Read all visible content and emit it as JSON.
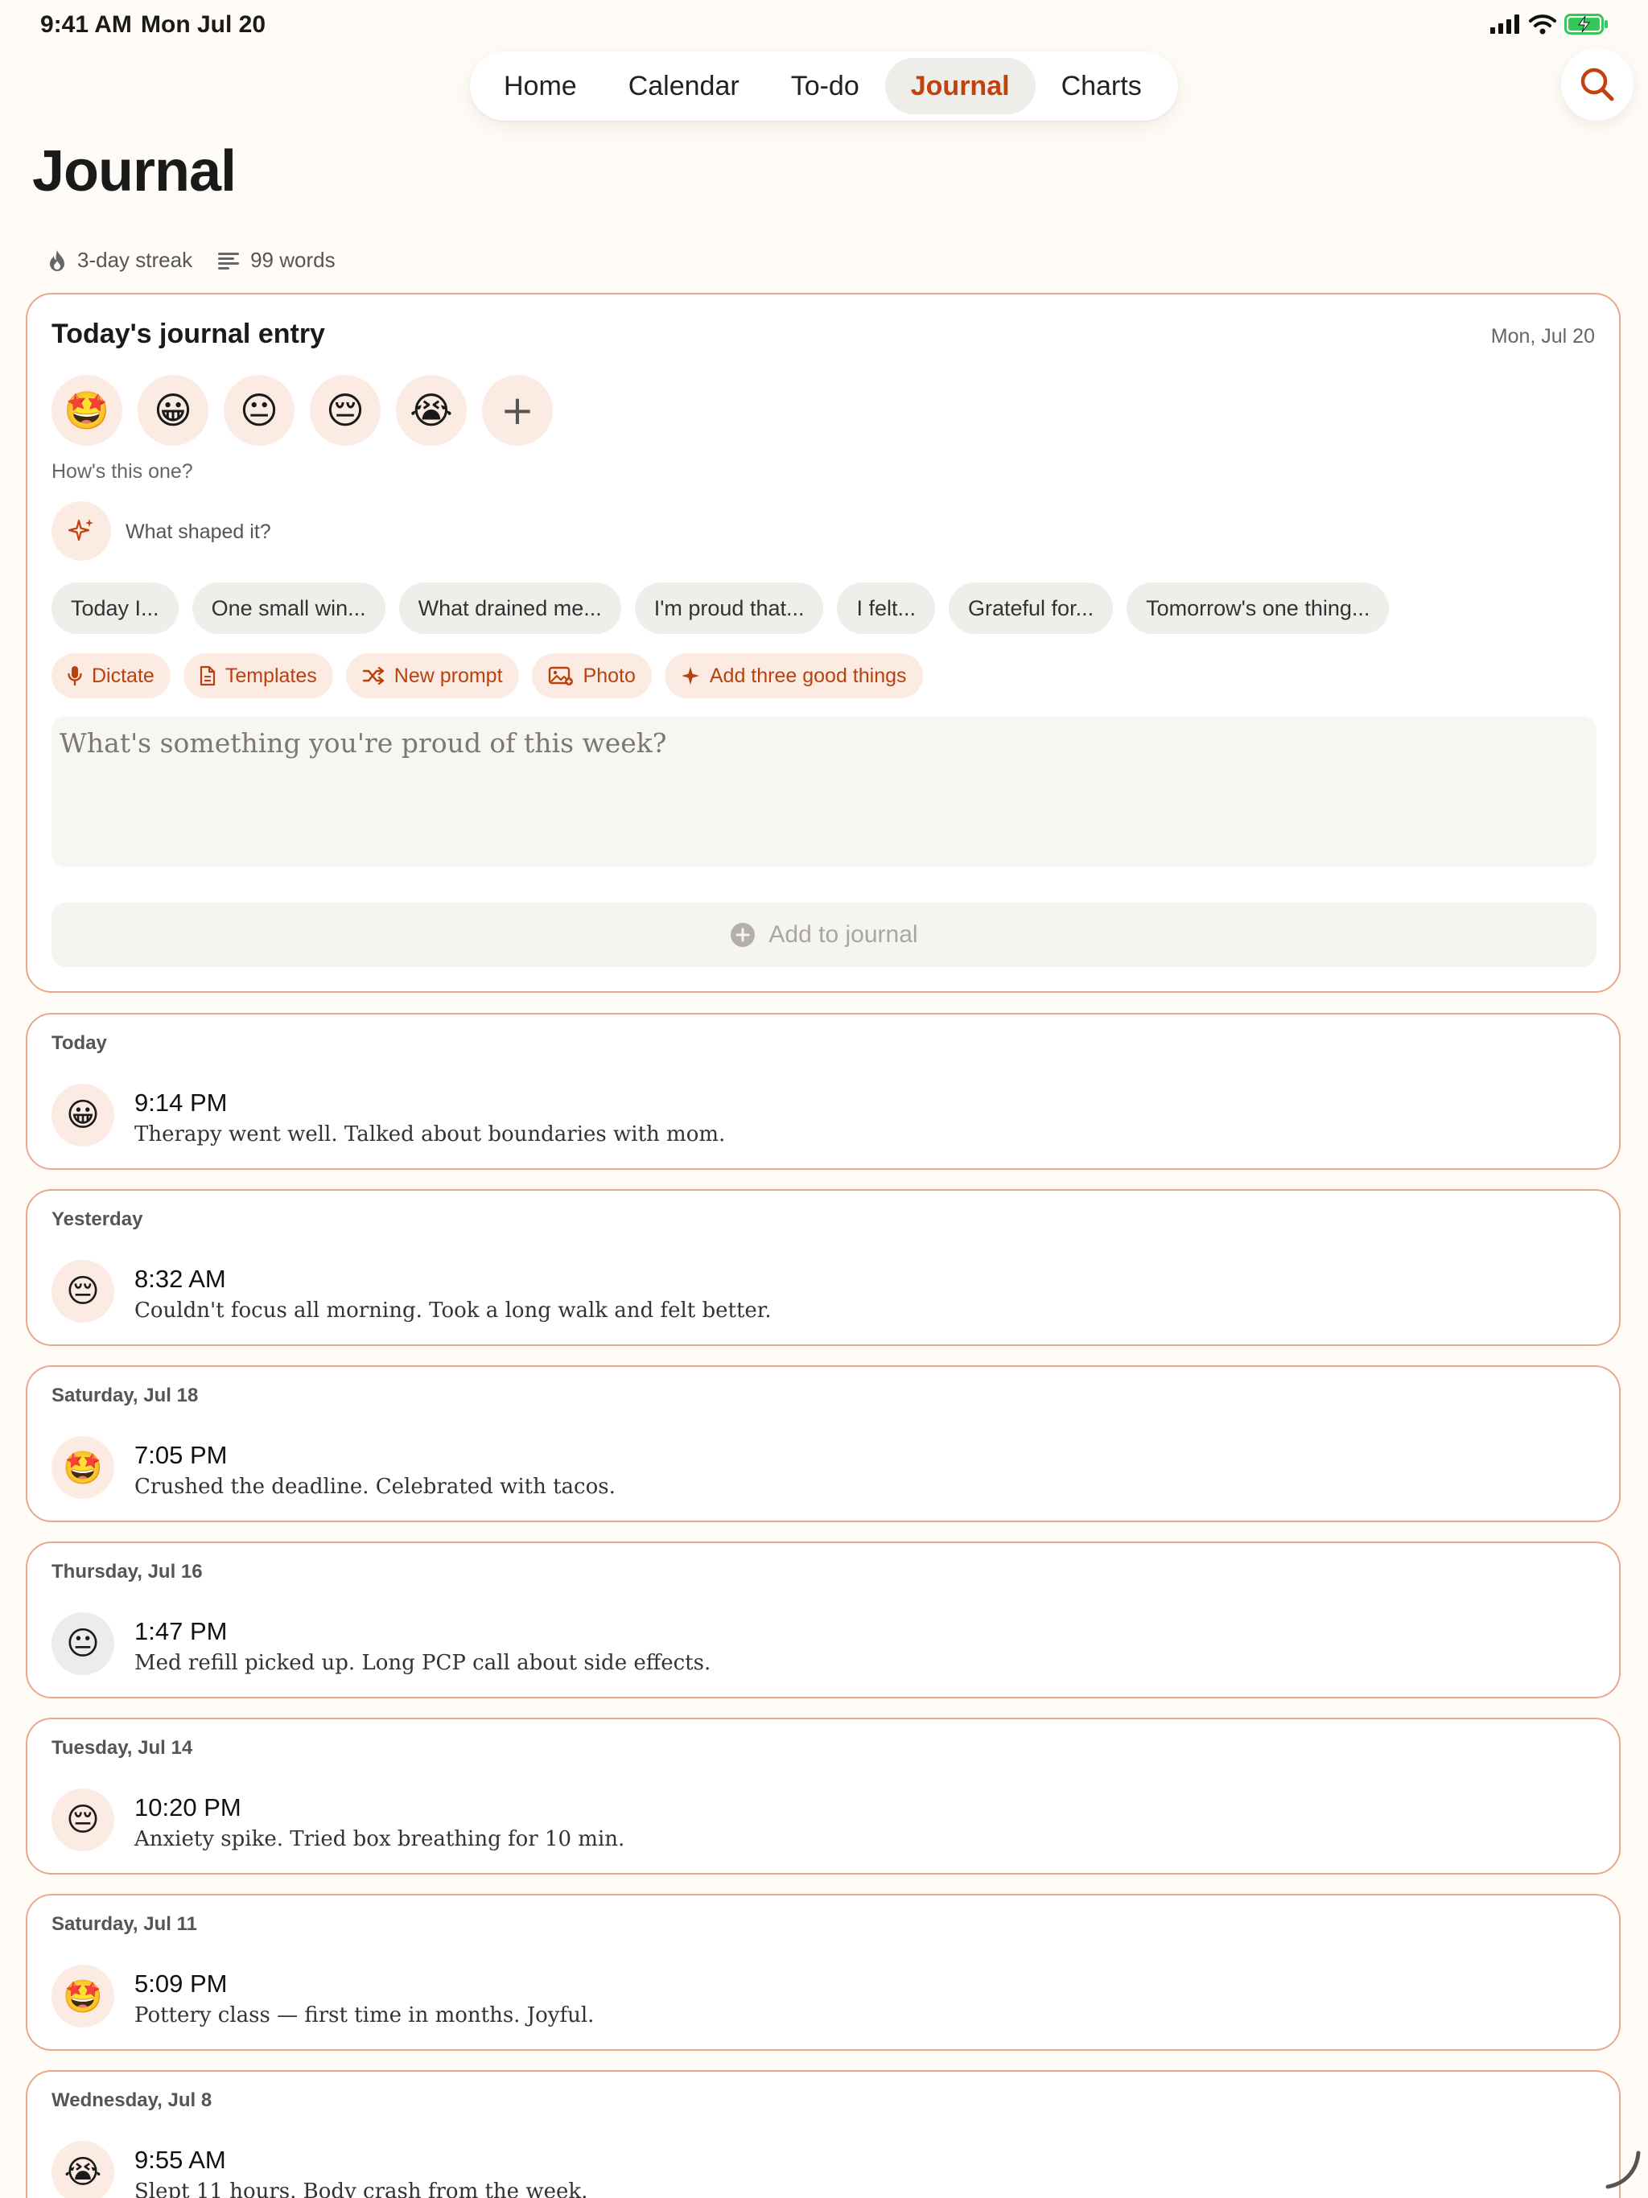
{
  "status_bar": {
    "time": "9:41 AM",
    "date": "Mon Jul 20"
  },
  "nav": {
    "tabs": [
      {
        "label": "Home"
      },
      {
        "label": "Calendar"
      },
      {
        "label": "To-do"
      },
      {
        "label": "Journal",
        "active": true
      },
      {
        "label": "Charts"
      }
    ]
  },
  "page": {
    "title": "Journal"
  },
  "stats": {
    "streak": "3-day streak",
    "words": "99 words"
  },
  "composer": {
    "title": "Today's journal entry",
    "date": "Mon, Jul 20",
    "moods": [
      "star-struck-face",
      "grinning-face",
      "neutral-face",
      "pensive-face",
      "crying-face"
    ],
    "add_mood": "+",
    "hows_label": "How's this one?",
    "shaped_label": "What shaped it?",
    "chips": [
      "Today I...",
      "One small win...",
      "What drained me...",
      "I'm proud that...",
      "I felt...",
      "Grateful for...",
      "Tomorrow's one thing..."
    ],
    "actions": [
      "Dictate",
      "Templates",
      "New prompt",
      "Photo",
      "Add three good things"
    ],
    "placeholder": "What's something you're proud of this week?",
    "submit": "Add to journal"
  },
  "entries": [
    {
      "day": "Today",
      "time": "9:14 PM",
      "text": "Therapy went well. Talked about boundaries with mom.",
      "mood": "grinning-face"
    },
    {
      "day": "Yesterday",
      "time": "8:32 AM",
      "text": "Couldn't focus all morning. Took a long walk and felt better.",
      "mood": "pensive-face"
    },
    {
      "day": "Saturday, Jul 18",
      "time": "7:05 PM",
      "text": "Crushed the deadline. Celebrated with tacos.",
      "mood": "star-struck-face"
    },
    {
      "day": "Thursday, Jul 16",
      "time": "1:47 PM",
      "text": "Med refill picked up. Long PCP call about side effects.",
      "mood": "neutral-face"
    },
    {
      "day": "Tuesday, Jul 14",
      "time": "10:20 PM",
      "text": "Anxiety spike. Tried box breathing for 10 min.",
      "mood": "pensive-face"
    },
    {
      "day": "Saturday, Jul 11",
      "time": "5:09 PM",
      "text": "Pottery class — first time in months. Joyful.",
      "mood": "star-struck-face"
    },
    {
      "day": "Wednesday, Jul 8",
      "time": "9:55 AM",
      "text": "Slept 11 hours. Body crash from the week.",
      "mood": "crying-face"
    }
  ],
  "colors": {
    "accent": "#c2410c",
    "card_border": "#e9a88b",
    "mood_bg": "#fbebe3",
    "background": "#fffcf8"
  }
}
